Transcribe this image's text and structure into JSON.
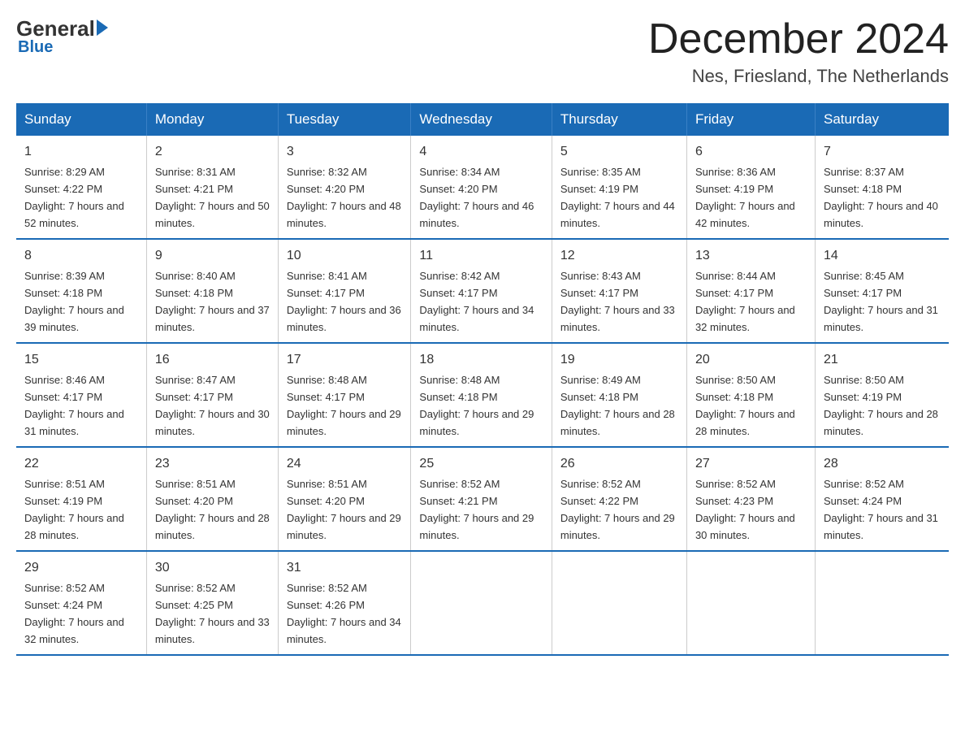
{
  "header": {
    "logo_general": "General",
    "logo_blue": "Blue",
    "month_title": "December 2024",
    "location": "Nes, Friesland, The Netherlands"
  },
  "weekdays": [
    "Sunday",
    "Monday",
    "Tuesday",
    "Wednesday",
    "Thursday",
    "Friday",
    "Saturday"
  ],
  "weeks": [
    [
      {
        "day": "1",
        "sunrise": "Sunrise: 8:29 AM",
        "sunset": "Sunset: 4:22 PM",
        "daylight": "Daylight: 7 hours and 52 minutes."
      },
      {
        "day": "2",
        "sunrise": "Sunrise: 8:31 AM",
        "sunset": "Sunset: 4:21 PM",
        "daylight": "Daylight: 7 hours and 50 minutes."
      },
      {
        "day": "3",
        "sunrise": "Sunrise: 8:32 AM",
        "sunset": "Sunset: 4:20 PM",
        "daylight": "Daylight: 7 hours and 48 minutes."
      },
      {
        "day": "4",
        "sunrise": "Sunrise: 8:34 AM",
        "sunset": "Sunset: 4:20 PM",
        "daylight": "Daylight: 7 hours and 46 minutes."
      },
      {
        "day": "5",
        "sunrise": "Sunrise: 8:35 AM",
        "sunset": "Sunset: 4:19 PM",
        "daylight": "Daylight: 7 hours and 44 minutes."
      },
      {
        "day": "6",
        "sunrise": "Sunrise: 8:36 AM",
        "sunset": "Sunset: 4:19 PM",
        "daylight": "Daylight: 7 hours and 42 minutes."
      },
      {
        "day": "7",
        "sunrise": "Sunrise: 8:37 AM",
        "sunset": "Sunset: 4:18 PM",
        "daylight": "Daylight: 7 hours and 40 minutes."
      }
    ],
    [
      {
        "day": "8",
        "sunrise": "Sunrise: 8:39 AM",
        "sunset": "Sunset: 4:18 PM",
        "daylight": "Daylight: 7 hours and 39 minutes."
      },
      {
        "day": "9",
        "sunrise": "Sunrise: 8:40 AM",
        "sunset": "Sunset: 4:18 PM",
        "daylight": "Daylight: 7 hours and 37 minutes."
      },
      {
        "day": "10",
        "sunrise": "Sunrise: 8:41 AM",
        "sunset": "Sunset: 4:17 PM",
        "daylight": "Daylight: 7 hours and 36 minutes."
      },
      {
        "day": "11",
        "sunrise": "Sunrise: 8:42 AM",
        "sunset": "Sunset: 4:17 PM",
        "daylight": "Daylight: 7 hours and 34 minutes."
      },
      {
        "day": "12",
        "sunrise": "Sunrise: 8:43 AM",
        "sunset": "Sunset: 4:17 PM",
        "daylight": "Daylight: 7 hours and 33 minutes."
      },
      {
        "day": "13",
        "sunrise": "Sunrise: 8:44 AM",
        "sunset": "Sunset: 4:17 PM",
        "daylight": "Daylight: 7 hours and 32 minutes."
      },
      {
        "day": "14",
        "sunrise": "Sunrise: 8:45 AM",
        "sunset": "Sunset: 4:17 PM",
        "daylight": "Daylight: 7 hours and 31 minutes."
      }
    ],
    [
      {
        "day": "15",
        "sunrise": "Sunrise: 8:46 AM",
        "sunset": "Sunset: 4:17 PM",
        "daylight": "Daylight: 7 hours and 31 minutes."
      },
      {
        "day": "16",
        "sunrise": "Sunrise: 8:47 AM",
        "sunset": "Sunset: 4:17 PM",
        "daylight": "Daylight: 7 hours and 30 minutes."
      },
      {
        "day": "17",
        "sunrise": "Sunrise: 8:48 AM",
        "sunset": "Sunset: 4:17 PM",
        "daylight": "Daylight: 7 hours and 29 minutes."
      },
      {
        "day": "18",
        "sunrise": "Sunrise: 8:48 AM",
        "sunset": "Sunset: 4:18 PM",
        "daylight": "Daylight: 7 hours and 29 minutes."
      },
      {
        "day": "19",
        "sunrise": "Sunrise: 8:49 AM",
        "sunset": "Sunset: 4:18 PM",
        "daylight": "Daylight: 7 hours and 28 minutes."
      },
      {
        "day": "20",
        "sunrise": "Sunrise: 8:50 AM",
        "sunset": "Sunset: 4:18 PM",
        "daylight": "Daylight: 7 hours and 28 minutes."
      },
      {
        "day": "21",
        "sunrise": "Sunrise: 8:50 AM",
        "sunset": "Sunset: 4:19 PM",
        "daylight": "Daylight: 7 hours and 28 minutes."
      }
    ],
    [
      {
        "day": "22",
        "sunrise": "Sunrise: 8:51 AM",
        "sunset": "Sunset: 4:19 PM",
        "daylight": "Daylight: 7 hours and 28 minutes."
      },
      {
        "day": "23",
        "sunrise": "Sunrise: 8:51 AM",
        "sunset": "Sunset: 4:20 PM",
        "daylight": "Daylight: 7 hours and 28 minutes."
      },
      {
        "day": "24",
        "sunrise": "Sunrise: 8:51 AM",
        "sunset": "Sunset: 4:20 PM",
        "daylight": "Daylight: 7 hours and 29 minutes."
      },
      {
        "day": "25",
        "sunrise": "Sunrise: 8:52 AM",
        "sunset": "Sunset: 4:21 PM",
        "daylight": "Daylight: 7 hours and 29 minutes."
      },
      {
        "day": "26",
        "sunrise": "Sunrise: 8:52 AM",
        "sunset": "Sunset: 4:22 PM",
        "daylight": "Daylight: 7 hours and 29 minutes."
      },
      {
        "day": "27",
        "sunrise": "Sunrise: 8:52 AM",
        "sunset": "Sunset: 4:23 PM",
        "daylight": "Daylight: 7 hours and 30 minutes."
      },
      {
        "day": "28",
        "sunrise": "Sunrise: 8:52 AM",
        "sunset": "Sunset: 4:24 PM",
        "daylight": "Daylight: 7 hours and 31 minutes."
      }
    ],
    [
      {
        "day": "29",
        "sunrise": "Sunrise: 8:52 AM",
        "sunset": "Sunset: 4:24 PM",
        "daylight": "Daylight: 7 hours and 32 minutes."
      },
      {
        "day": "30",
        "sunrise": "Sunrise: 8:52 AM",
        "sunset": "Sunset: 4:25 PM",
        "daylight": "Daylight: 7 hours and 33 minutes."
      },
      {
        "day": "31",
        "sunrise": "Sunrise: 8:52 AM",
        "sunset": "Sunset: 4:26 PM",
        "daylight": "Daylight: 7 hours and 34 minutes."
      },
      {
        "day": "",
        "sunrise": "",
        "sunset": "",
        "daylight": ""
      },
      {
        "day": "",
        "sunrise": "",
        "sunset": "",
        "daylight": ""
      },
      {
        "day": "",
        "sunrise": "",
        "sunset": "",
        "daylight": ""
      },
      {
        "day": "",
        "sunrise": "",
        "sunset": "",
        "daylight": ""
      }
    ]
  ]
}
